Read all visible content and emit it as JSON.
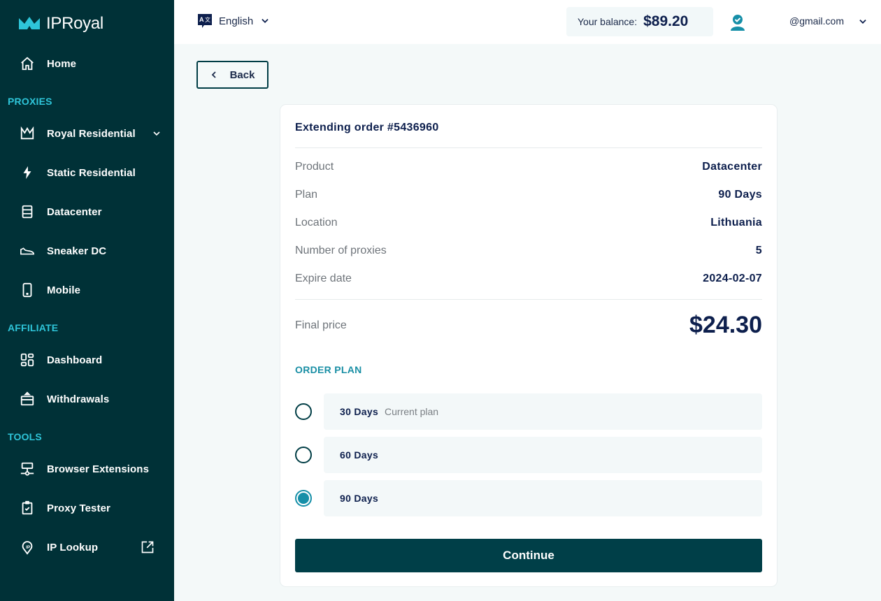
{
  "brand": {
    "name": "IPRoyal",
    "accent": "#2ec5d9",
    "sidebar_bg": "#003137"
  },
  "sidebar": {
    "home": {
      "label": "Home",
      "icon": "home-icon"
    },
    "sections": [
      {
        "title": "PROXIES",
        "items": [
          {
            "label": "Royal Residential",
            "icon": "crown-icon",
            "trailing": "chevron-down-icon"
          },
          {
            "label": "Static Residential",
            "icon": "lightning-icon"
          },
          {
            "label": "Datacenter",
            "icon": "server-icon"
          },
          {
            "label": "Sneaker DC",
            "icon": "sneaker-icon"
          },
          {
            "label": "Mobile",
            "icon": "mobile-icon"
          }
        ]
      },
      {
        "title": "AFFILIATE",
        "items": [
          {
            "label": "Dashboard",
            "icon": "dashboard-icon"
          },
          {
            "label": "Withdrawals",
            "icon": "wallet-icon"
          }
        ]
      },
      {
        "title": "TOOLS",
        "items": [
          {
            "label": "Browser Extensions",
            "icon": "network-icon"
          },
          {
            "label": "Proxy Tester",
            "icon": "clipboard-check-icon"
          },
          {
            "label": "IP Lookup",
            "icon": "ip-pin-icon",
            "trailing": "external-link-icon"
          }
        ]
      }
    ]
  },
  "topbar": {
    "language": "English",
    "balance_label": "Your balance:",
    "balance_value": "$89.20",
    "email": "@gmail.com"
  },
  "back_label": "Back",
  "order": {
    "title": "Extending order #5436960",
    "details": [
      {
        "key": "Product",
        "value": "Datacenter"
      },
      {
        "key": "Plan",
        "value": "90 Days"
      },
      {
        "key": "Location",
        "value": "Lithuania"
      },
      {
        "key": "Number of proxies",
        "value": "5"
      },
      {
        "key": "Expire date",
        "value": "2024-02-07"
      }
    ],
    "final_price_label": "Final price",
    "final_price": "$24.30",
    "order_plan_label": "ORDER PLAN",
    "plans": [
      {
        "name": "30 Days",
        "note": "Current plan",
        "selected": false
      },
      {
        "name": "60 Days",
        "note": "",
        "selected": false
      },
      {
        "name": "90 Days",
        "note": "",
        "selected": true
      }
    ],
    "continue_label": "Continue"
  }
}
